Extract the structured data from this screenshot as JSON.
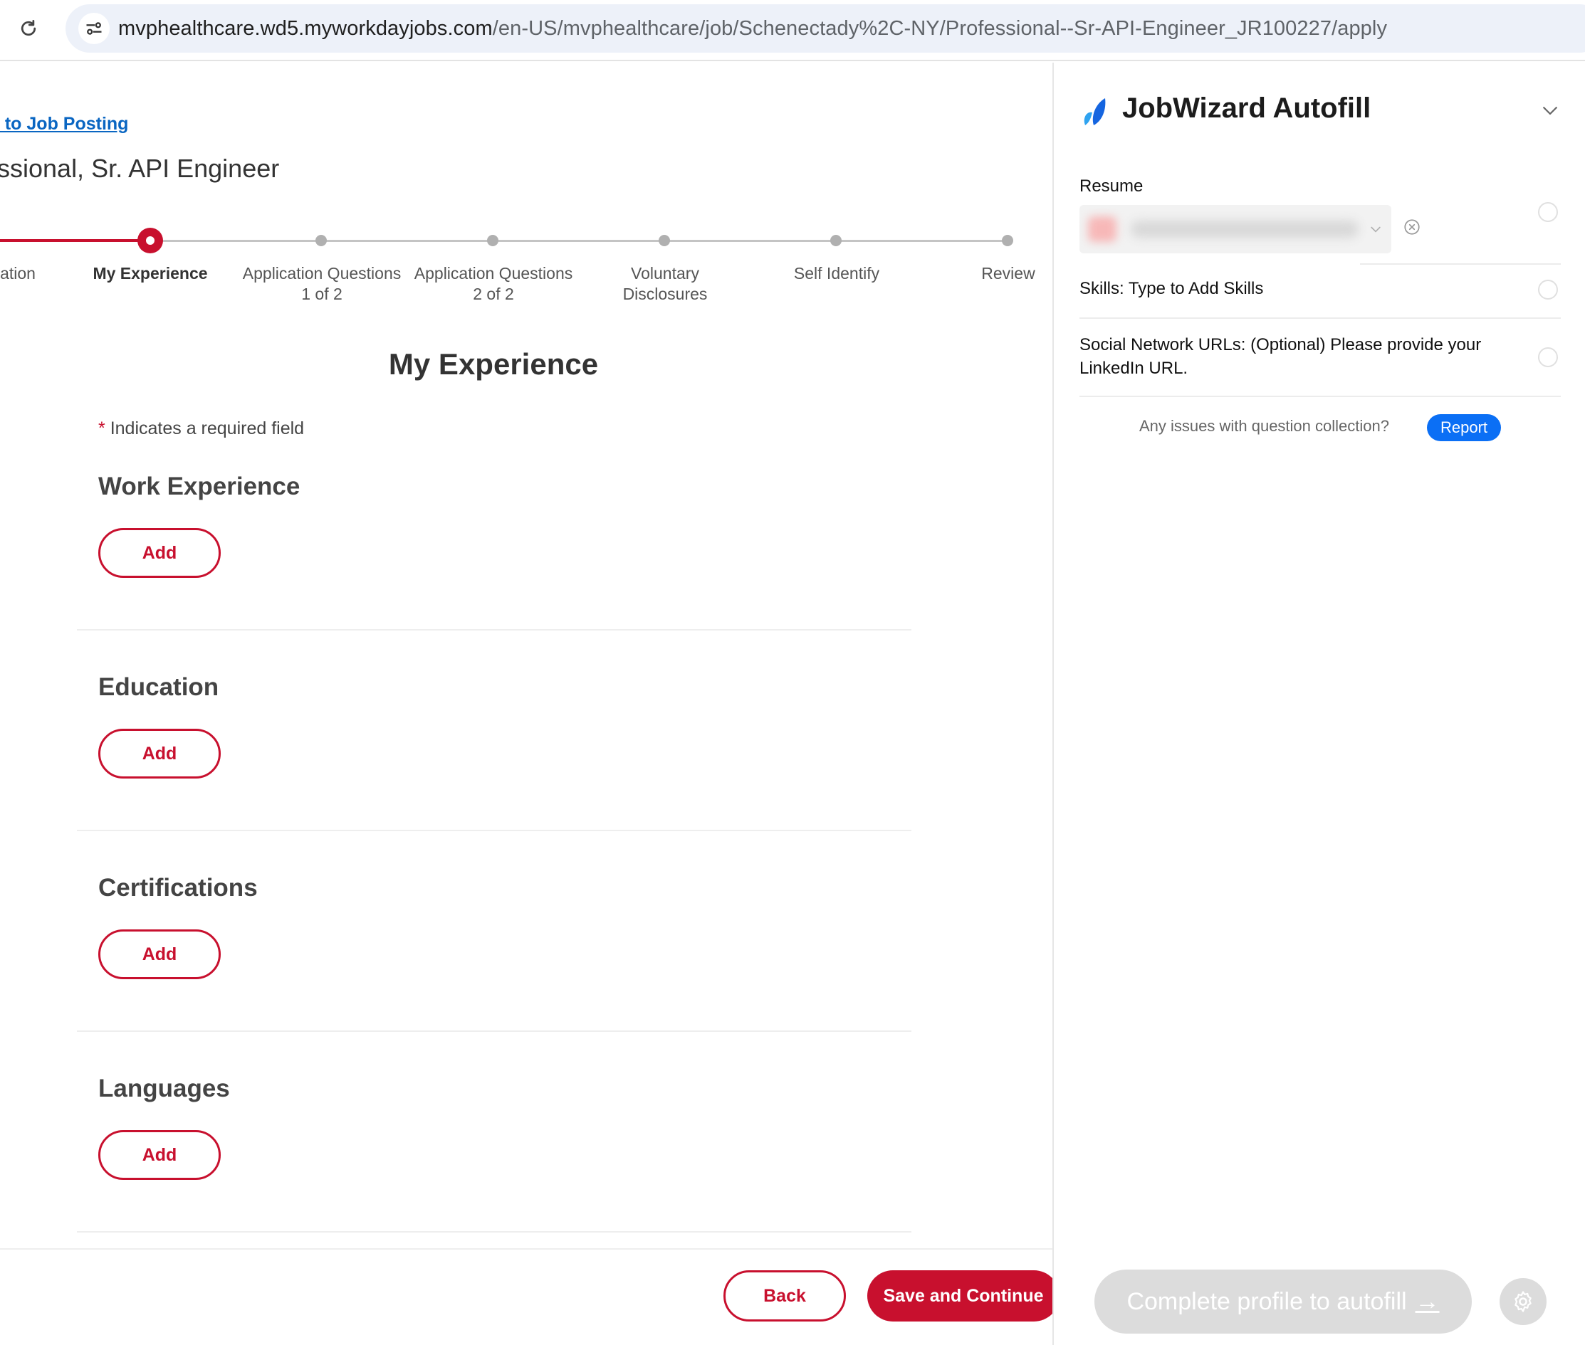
{
  "browser": {
    "url_host": "mvphealthcare.wd5.myworkdayjobs.com",
    "url_path": "/en-US/mvphealthcare/job/Schenectady%2C-NY/Professional--Sr-API-Engineer_JR100227/apply"
  },
  "page": {
    "back_link": "k to Job Posting",
    "job_title": "ssional, Sr. API Engineer",
    "steps": [
      {
        "label": "ation",
        "state": "done"
      },
      {
        "label": "My Experience",
        "state": "current"
      },
      {
        "label": "Application Questions 1 of 2",
        "state": "upcoming"
      },
      {
        "label": "Application Questions 2 of 2",
        "state": "upcoming"
      },
      {
        "label": "Voluntary Disclosures",
        "state": "upcoming"
      },
      {
        "label": "Self Identify",
        "state": "upcoming"
      },
      {
        "label": "Review",
        "state": "upcoming"
      }
    ],
    "section_heading": "My Experience",
    "required_star": "*",
    "required_note": "Indicates a required field",
    "blocks": [
      {
        "title": "Work Experience",
        "button": "Add"
      },
      {
        "title": "Education",
        "button": "Add"
      },
      {
        "title": "Certifications",
        "button": "Add"
      },
      {
        "title": "Languages",
        "button": "Add"
      }
    ],
    "back_button": "Back",
    "save_button": "Save and Continue"
  },
  "panel": {
    "title": "JobWizard Autofill",
    "resume_label": "Resume",
    "skills_label": "Skills: Type to Add Skills",
    "social_label": "Social Network URLs: (Optional) Please provide your LinkedIn URL.",
    "issues_text": "Any issues with question collection?",
    "report_button": "Report",
    "autofill_button": "Complete profile to autofill",
    "autofill_arrow": "→"
  },
  "colors": {
    "brand_red": "#c8102e",
    "link_blue": "#0a66c2",
    "report_blue": "#0b6ff5"
  }
}
